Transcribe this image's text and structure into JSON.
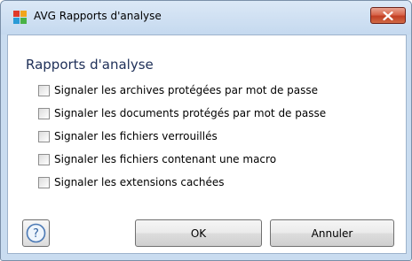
{
  "window": {
    "title": "AVG Rapports d'analyse",
    "app_icon": "avg-logo-icon",
    "close_icon": "close-icon"
  },
  "dialog": {
    "heading": "Rapports d'analyse",
    "options": [
      {
        "label": "Signaler les archives protégées par mot de passe",
        "checked": false
      },
      {
        "label": "Signaler les documents protégés par mot de passe",
        "checked": false
      },
      {
        "label": "Signaler les fichiers verrouillés",
        "checked": false
      },
      {
        "label": "Signaler les fichiers contenant une macro",
        "checked": false
      },
      {
        "label": "Signaler les extensions cachées",
        "checked": false
      }
    ]
  },
  "buttons": {
    "help_icon": "question-mark-icon",
    "ok_label": "OK",
    "cancel_label": "Annuler"
  },
  "colors": {
    "title_bar": "#c9dcf0",
    "heading_text": "#1e2f58",
    "close_button": "#c94b32"
  }
}
